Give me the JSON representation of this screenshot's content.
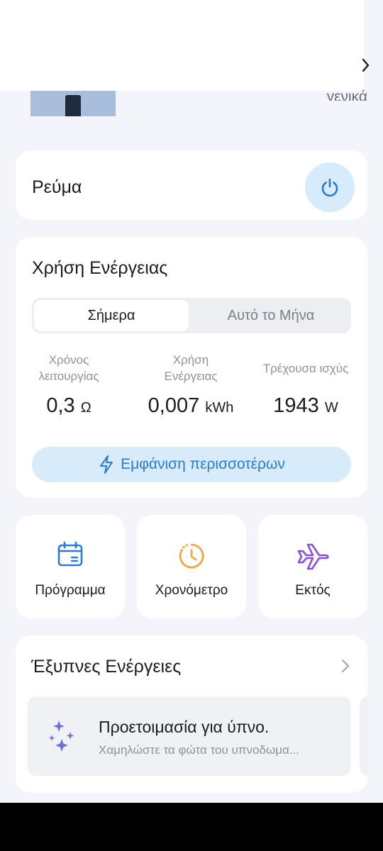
{
  "header": {
    "partial_label": "γενικά"
  },
  "power": {
    "label": "Ρεύμα"
  },
  "energy": {
    "title": "Χρήση Ενέργειας",
    "tabs": {
      "today": "Σήμερα",
      "month": "Αυτό το Μήνα"
    },
    "stats": {
      "runtime": {
        "caption": "Χρόνος λειτουργίας",
        "value": "0,3",
        "unit": "Ω"
      },
      "usage": {
        "caption": "Χρήση Ενέργειας",
        "value": "0,007",
        "unit": "kWh"
      },
      "power": {
        "caption": "Τρέχουσα ισχύς",
        "value": "1943",
        "unit": "W"
      }
    },
    "more_label": "Εμφάνιση περισσοτέρων"
  },
  "tiles": {
    "schedule": "Πρόγραμμα",
    "timer": "Χρονόμετρο",
    "away": "Εκτός"
  },
  "smart": {
    "title": "Έξυπνες Ενέργειες",
    "scene_title": "Προετοιμασία για ύπνο.",
    "scene_subtitle": "Χαμηλώστε τα φώτα του υπνοδωμα..."
  },
  "colors": {
    "accent_blue": "#2a7ad6",
    "power_bg": "#d6ebfb",
    "timer_orange": "#f2a83b",
    "away_purple": "#8a4fe0",
    "sparkle_purple": "#6b6fd8"
  }
}
